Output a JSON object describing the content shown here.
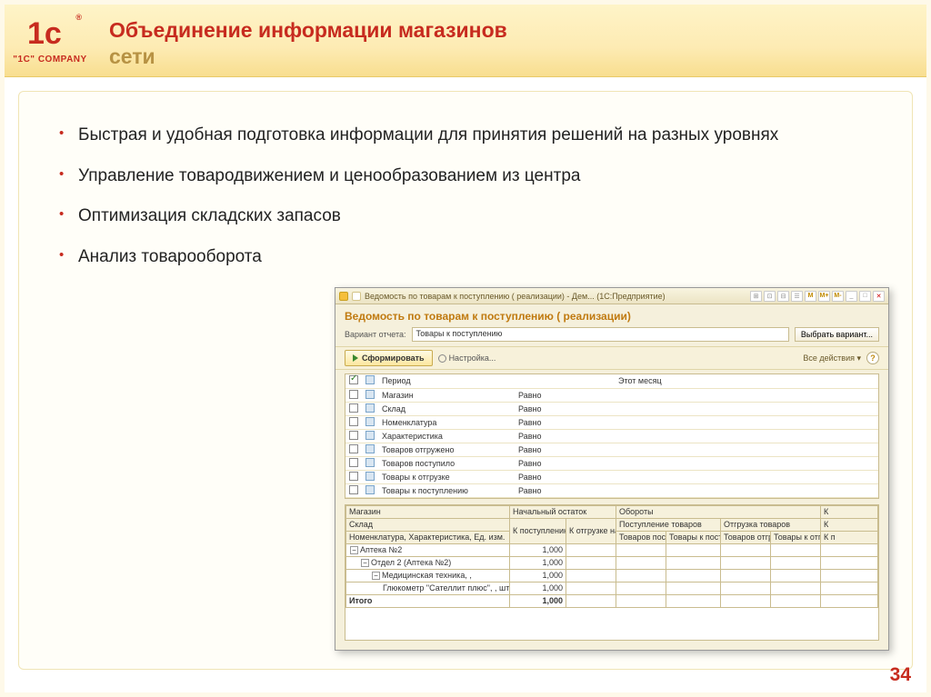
{
  "slide": {
    "title_line1": "Объединение информации магазинов",
    "title_line2": "сети",
    "logo_text": "\"1C\" COMPANY",
    "page_number": "34"
  },
  "bullets": [
    "Быстрая и удобная подготовка информации для принятия решений на разных уровнях",
    "Управление товародвижением и ценообразованием из центра",
    "Оптимизация складских запасов",
    "Анализ товарооборота"
  ],
  "app": {
    "window_title": "Ведомость по товарам к поступлению ( реализации) - Дем... (1С:Предприятие)",
    "heading": "Ведомость по товарам к поступлению ( реализации)",
    "variant_label": "Вариант отчета:",
    "variant_value": "Товары к поступлению",
    "choose_variant_btn": "Выбрать вариант...",
    "generate_btn": "Сформировать",
    "settings_link": "Настройка...",
    "all_actions": "Все действия ▾",
    "toolbar_letters": [
      "M",
      "M+",
      "M-"
    ],
    "filters": [
      {
        "checked": true,
        "name": "Период",
        "cond": "",
        "val": "Этот месяц"
      },
      {
        "checked": false,
        "name": "Магазин",
        "cond": "Равно",
        "val": ""
      },
      {
        "checked": false,
        "name": "Склад",
        "cond": "Равно",
        "val": ""
      },
      {
        "checked": false,
        "name": "Номенклатура",
        "cond": "Равно",
        "val": ""
      },
      {
        "checked": false,
        "name": "Характеристика",
        "cond": "Равно",
        "val": ""
      },
      {
        "checked": false,
        "name": "Товаров отгружено",
        "cond": "Равно",
        "val": ""
      },
      {
        "checked": false,
        "name": "Товаров поступило",
        "cond": "Равно",
        "val": ""
      },
      {
        "checked": false,
        "name": "Товары к отгрузке",
        "cond": "Равно",
        "val": ""
      },
      {
        "checked": false,
        "name": "Товары к поступлению",
        "cond": "Равно",
        "val": ""
      }
    ],
    "report": {
      "head1": {
        "c1": "Магазин",
        "c2": "Начальный остаток",
        "c3": "Обороты",
        "c4": "К"
      },
      "head2": {
        "c1": "Склад",
        "c2a": "К поступлению нач. ост.",
        "c2b": "К отгрузке нач. ост.",
        "c3a": "Поступление товаров",
        "c3b": "Отгрузка товаров",
        "c4a": "К"
      },
      "head3": {
        "c1": "Номенклатура, Характеристика, Ед. изм.",
        "c3a1": "Товаров поступило",
        "c3a2": "Товары к поступлению",
        "c3b1": "Товаров отгружено",
        "c3b2": "Товары к отгрузке",
        "c4a": "К п"
      },
      "rows": [
        {
          "label": "Аптека №2",
          "indent": 0,
          "val": "1,000"
        },
        {
          "label": "Отдел 2 (Аптека №2)",
          "indent": 1,
          "val": "1,000"
        },
        {
          "label": "Медицинская техника, ,",
          "indent": 2,
          "val": "1,000"
        },
        {
          "label": "Глюкометр \"Сателлит плюс\", , шт",
          "indent": 3,
          "val": "1,000"
        }
      ],
      "total_label": "Итого",
      "total_val": "1,000"
    }
  }
}
